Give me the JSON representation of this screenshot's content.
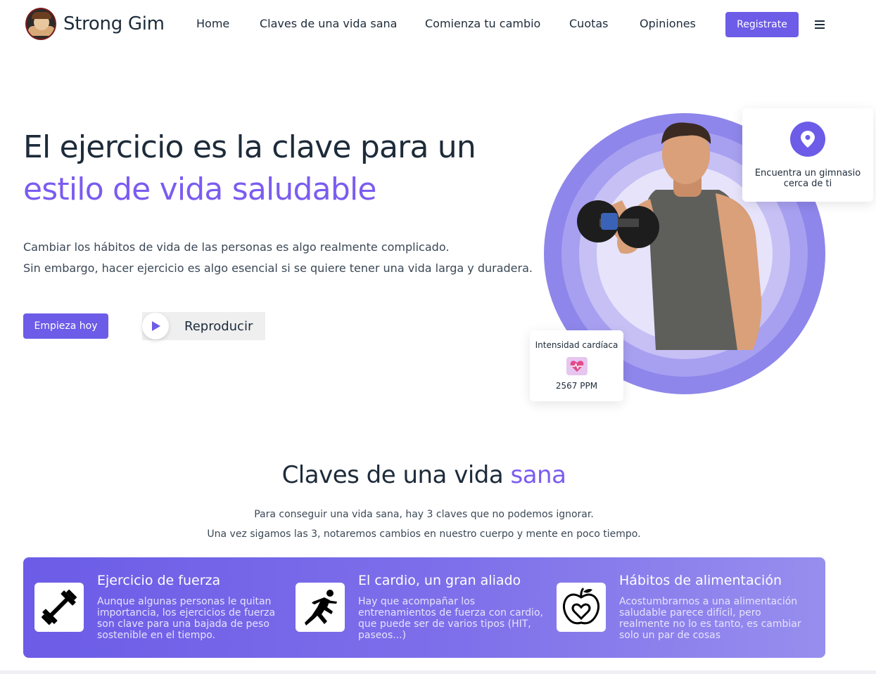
{
  "brand": {
    "name": "Strong Gim"
  },
  "nav": {
    "links": [
      "Home",
      "Claves de una vida sana",
      "Comienza tu cambio",
      "Cuotas",
      "Opiniones"
    ],
    "register_label": "Registrate"
  },
  "hero": {
    "title_line1": "El ejercicio es la clave para un",
    "title_line2": "estilo de vida saludable",
    "text_line1": "Cambiar los hábitos de vida de las personas es algo realmente complicado.",
    "text_line2": "Sin embargo, hacer ejercicio es algo esencial si se quiere tener una vida larga y duradera.",
    "start_label": "Empieza hoy",
    "play_label": "Reproducir"
  },
  "gym_card": {
    "text": "Encuentra un gimnasio cerca de ti"
  },
  "heart_card": {
    "title": "Intensidad cardíaca",
    "value": "2567 PPM"
  },
  "keys": {
    "title_main": "Claves de una vida ",
    "title_accent": "sana",
    "sub_line1": "Para conseguir una vida sana, hay 3 claves que no podemos ignorar.",
    "sub_line2": "Una vez sigamos las 3, notaremos cambios en nuestro cuerpo y mente en poco tiempo.",
    "features": [
      {
        "icon": "dumbbell-icon",
        "title": "Ejercicio de fuerza",
        "text": "Aunque algunas personas le quitan importancia, los ejercicios de fuerza son clave para una bajada de peso sostenible en el tiempo."
      },
      {
        "icon": "runner-icon",
        "title": "El cardio, un gran aliado",
        "text": "Hay que acompañar los entrenamientos de fuerza con cardio, que puede ser de varios tipos (HIT, paseos...)"
      },
      {
        "icon": "apple-heart-icon",
        "title": "Hábitos de alimentación",
        "text": "Acostumbrarnos a una alimentación saludable parece difícil, pero realmente no lo es tanto, es cambiar solo un par de cosas"
      }
    ]
  },
  "colors": {
    "accent": "#6c5ce7",
    "accent_text": "#7b5cf0",
    "dark": "#1d2b3a"
  }
}
